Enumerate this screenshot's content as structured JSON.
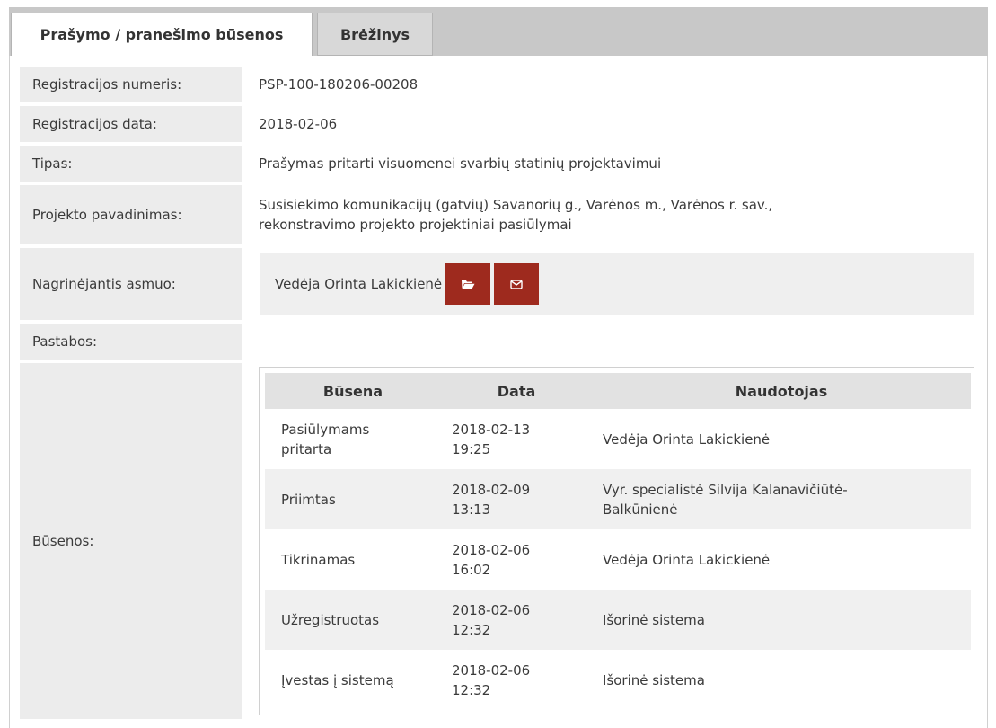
{
  "tabs": {
    "active": "Prašymo / pranešimo būsenos",
    "inactive": "Brėžinys"
  },
  "fields": {
    "reg_number_label": "Registracijos numeris:",
    "reg_number_value": "PSP-100-180206-00208",
    "reg_date_label": "Registracijos data:",
    "reg_date_value": "2018-02-06",
    "type_label": "Tipas:",
    "type_value": "Prašymas pritarti visuomenei svarbių statinių projektavimui",
    "project_label": "Projekto pavadinimas:",
    "project_value_line1": "Susisiekimo komunikacijų (gatvių) Savanorių g., Varėnos m., Varėnos r. sav.,",
    "project_value_line2": "rekonstravimo projekto projektiniai pasiūlymai",
    "person_label": "Nagrinėjantis asmuo:",
    "person_value": "Vedėja Orinta Lakickienė",
    "notes_label": "Pastabos:",
    "notes_value": "",
    "states_label": "Būsenos:"
  },
  "icons": {
    "folder": "folder-open-icon",
    "envelope": "envelope-icon",
    "button_color": "#9e2a1e"
  },
  "states_table": {
    "headers": [
      "Būsena",
      "Data",
      "Naudotojas"
    ],
    "rows": [
      {
        "state_l1": "Pasiūlymams",
        "state_l2": "pritarta",
        "date": "2018-02-13",
        "time": "19:25",
        "user_l1": "Vedėja Orinta Lakickienė",
        "user_l2": ""
      },
      {
        "state_l1": "Priimtas",
        "state_l2": "",
        "date": "2018-02-09",
        "time": "13:13",
        "user_l1": "Vyr. specialistė Silvija Kalanavičiūtė-",
        "user_l2": "Balkūnienė"
      },
      {
        "state_l1": "Tikrinamas",
        "state_l2": "",
        "date": "2018-02-06",
        "time": "16:02",
        "user_l1": "Vedėja Orinta Lakickienė",
        "user_l2": ""
      },
      {
        "state_l1": "Užregistruotas",
        "state_l2": "",
        "date": "2018-02-06",
        "time": "12:32",
        "user_l1": "Išorinė sistema",
        "user_l2": ""
      },
      {
        "state_l1": "Įvestas į sistemą",
        "state_l2": "",
        "date": "2018-02-06",
        "time": "12:32",
        "user_l1": "Išorinė sistema",
        "user_l2": ""
      }
    ]
  }
}
